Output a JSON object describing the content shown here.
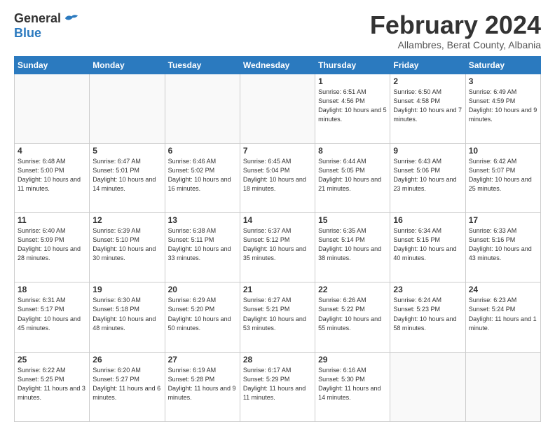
{
  "logo": {
    "general": "General",
    "blue": "Blue"
  },
  "title": "February 2024",
  "subtitle": "Allambres, Berat County, Albania",
  "days_of_week": [
    "Sunday",
    "Monday",
    "Tuesday",
    "Wednesday",
    "Thursday",
    "Friday",
    "Saturday"
  ],
  "weeks": [
    [
      {
        "day": "",
        "info": ""
      },
      {
        "day": "",
        "info": ""
      },
      {
        "day": "",
        "info": ""
      },
      {
        "day": "",
        "info": ""
      },
      {
        "day": "1",
        "info": "Sunrise: 6:51 AM\nSunset: 4:56 PM\nDaylight: 10 hours\nand 5 minutes."
      },
      {
        "day": "2",
        "info": "Sunrise: 6:50 AM\nSunset: 4:58 PM\nDaylight: 10 hours\nand 7 minutes."
      },
      {
        "day": "3",
        "info": "Sunrise: 6:49 AM\nSunset: 4:59 PM\nDaylight: 10 hours\nand 9 minutes."
      }
    ],
    [
      {
        "day": "4",
        "info": "Sunrise: 6:48 AM\nSunset: 5:00 PM\nDaylight: 10 hours\nand 11 minutes."
      },
      {
        "day": "5",
        "info": "Sunrise: 6:47 AM\nSunset: 5:01 PM\nDaylight: 10 hours\nand 14 minutes."
      },
      {
        "day": "6",
        "info": "Sunrise: 6:46 AM\nSunset: 5:02 PM\nDaylight: 10 hours\nand 16 minutes."
      },
      {
        "day": "7",
        "info": "Sunrise: 6:45 AM\nSunset: 5:04 PM\nDaylight: 10 hours\nand 18 minutes."
      },
      {
        "day": "8",
        "info": "Sunrise: 6:44 AM\nSunset: 5:05 PM\nDaylight: 10 hours\nand 21 minutes."
      },
      {
        "day": "9",
        "info": "Sunrise: 6:43 AM\nSunset: 5:06 PM\nDaylight: 10 hours\nand 23 minutes."
      },
      {
        "day": "10",
        "info": "Sunrise: 6:42 AM\nSunset: 5:07 PM\nDaylight: 10 hours\nand 25 minutes."
      }
    ],
    [
      {
        "day": "11",
        "info": "Sunrise: 6:40 AM\nSunset: 5:09 PM\nDaylight: 10 hours\nand 28 minutes."
      },
      {
        "day": "12",
        "info": "Sunrise: 6:39 AM\nSunset: 5:10 PM\nDaylight: 10 hours\nand 30 minutes."
      },
      {
        "day": "13",
        "info": "Sunrise: 6:38 AM\nSunset: 5:11 PM\nDaylight: 10 hours\nand 33 minutes."
      },
      {
        "day": "14",
        "info": "Sunrise: 6:37 AM\nSunset: 5:12 PM\nDaylight: 10 hours\nand 35 minutes."
      },
      {
        "day": "15",
        "info": "Sunrise: 6:35 AM\nSunset: 5:14 PM\nDaylight: 10 hours\nand 38 minutes."
      },
      {
        "day": "16",
        "info": "Sunrise: 6:34 AM\nSunset: 5:15 PM\nDaylight: 10 hours\nand 40 minutes."
      },
      {
        "day": "17",
        "info": "Sunrise: 6:33 AM\nSunset: 5:16 PM\nDaylight: 10 hours\nand 43 minutes."
      }
    ],
    [
      {
        "day": "18",
        "info": "Sunrise: 6:31 AM\nSunset: 5:17 PM\nDaylight: 10 hours\nand 45 minutes."
      },
      {
        "day": "19",
        "info": "Sunrise: 6:30 AM\nSunset: 5:18 PM\nDaylight: 10 hours\nand 48 minutes."
      },
      {
        "day": "20",
        "info": "Sunrise: 6:29 AM\nSunset: 5:20 PM\nDaylight: 10 hours\nand 50 minutes."
      },
      {
        "day": "21",
        "info": "Sunrise: 6:27 AM\nSunset: 5:21 PM\nDaylight: 10 hours\nand 53 minutes."
      },
      {
        "day": "22",
        "info": "Sunrise: 6:26 AM\nSunset: 5:22 PM\nDaylight: 10 hours\nand 55 minutes."
      },
      {
        "day": "23",
        "info": "Sunrise: 6:24 AM\nSunset: 5:23 PM\nDaylight: 10 hours\nand 58 minutes."
      },
      {
        "day": "24",
        "info": "Sunrise: 6:23 AM\nSunset: 5:24 PM\nDaylight: 11 hours\nand 1 minute."
      }
    ],
    [
      {
        "day": "25",
        "info": "Sunrise: 6:22 AM\nSunset: 5:25 PM\nDaylight: 11 hours\nand 3 minutes."
      },
      {
        "day": "26",
        "info": "Sunrise: 6:20 AM\nSunset: 5:27 PM\nDaylight: 11 hours\nand 6 minutes."
      },
      {
        "day": "27",
        "info": "Sunrise: 6:19 AM\nSunset: 5:28 PM\nDaylight: 11 hours\nand 9 minutes."
      },
      {
        "day": "28",
        "info": "Sunrise: 6:17 AM\nSunset: 5:29 PM\nDaylight: 11 hours\nand 11 minutes."
      },
      {
        "day": "29",
        "info": "Sunrise: 6:16 AM\nSunset: 5:30 PM\nDaylight: 11 hours\nand 14 minutes."
      },
      {
        "day": "",
        "info": ""
      },
      {
        "day": "",
        "info": ""
      }
    ]
  ]
}
